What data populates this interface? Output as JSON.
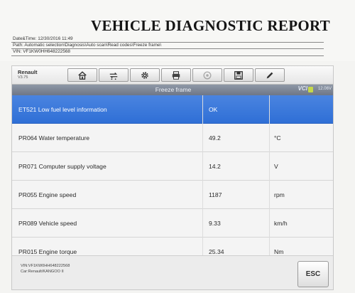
{
  "report": {
    "title": "VEHICLE DIAGNOSTIC REPORT",
    "datetime": "Date&Time: 12/30/2016 11:49",
    "path": "Path: Automatic selection\\Diagnosis\\Auto scan\\Read codes\\Freeze frame\\",
    "vin": "VIN: VF1KW0HH648222568"
  },
  "toolbar": {
    "brand": "Renault",
    "version": "V3.75",
    "buttons": [
      "home-icon",
      "vehicle-swap-icon",
      "gear-icon",
      "printer-icon",
      "help-icon",
      "save-icon",
      "pencil-icon"
    ]
  },
  "subbar": {
    "title": "Freeze frame",
    "vci": "VCI",
    "voltage": "12.06V"
  },
  "rows": [
    {
      "name": "ET521  Low fuel level information",
      "value": "OK",
      "unit": ""
    },
    {
      "name": "PR064  Water temperature",
      "value": "49.2",
      "unit": "°C"
    },
    {
      "name": "PR071  Computer supply voltage",
      "value": "14.2",
      "unit": "V"
    },
    {
      "name": "PR055  Engine speed",
      "value": "1187",
      "unit": "rpm"
    },
    {
      "name": "PR089  Vehicle speed",
      "value": "9.33",
      "unit": "km/h"
    },
    {
      "name": "PR015  Engine torque",
      "value": "25.34",
      "unit": "Nm"
    }
  ],
  "footer": {
    "vin": "VIN:VF1KW0HH648222568",
    "car": "Car:Renault/KANGOO II",
    "esc_label": "ESC"
  },
  "colors": {
    "selected_row": "#3576da",
    "subbar": "#7e8797"
  }
}
